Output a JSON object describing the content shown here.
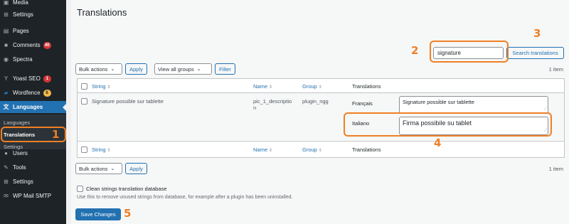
{
  "sidebar": {
    "items": [
      {
        "label": "Media",
        "icon": "media-icon"
      },
      {
        "label": "Settings",
        "icon": "settings-icon"
      },
      {
        "label": "Pages",
        "icon": "pages-icon"
      },
      {
        "label": "Comments",
        "icon": "comments-icon",
        "badge": "40"
      },
      {
        "label": "Spectra",
        "icon": "spectra-icon"
      },
      {
        "label": "Yoast SEO",
        "icon": "yoast-icon",
        "badge": "1"
      },
      {
        "label": "Wordfence",
        "icon": "wordfence-icon",
        "badge": "6"
      },
      {
        "label": "Languages",
        "icon": "languages-icon"
      },
      {
        "label": "Users",
        "icon": "users-icon"
      },
      {
        "label": "Tools",
        "icon": "tools-icon"
      },
      {
        "label": "Settings",
        "icon": "settings-icon"
      },
      {
        "label": "WP Mail SMTP",
        "icon": "mail-icon"
      }
    ],
    "submenu": [
      "Languages",
      "Translations",
      "Settings"
    ]
  },
  "page": {
    "title": "Translations"
  },
  "search": {
    "value": "signature",
    "button": "Search translations"
  },
  "bulk": {
    "label": "Bulk actions",
    "apply": "Apply",
    "groups": "View all groups",
    "filter": "Filter"
  },
  "count": "1 item",
  "table": {
    "headers": {
      "string": "String",
      "name": "Name",
      "group": "Group",
      "translations": "Translations"
    },
    "row": {
      "string": "Signature possible sur tablette",
      "name_line1": "pic_1_descriptio",
      "name_line2": "n",
      "group": "plugin_ngg",
      "translations": [
        {
          "lang": "Français",
          "value": "Signature possible sur tablette"
        },
        {
          "lang": "Italiano",
          "value": "Firma possibile su tablet"
        }
      ]
    }
  },
  "clean": {
    "label": "Clean strings translation database",
    "help": "Use this to remove unused strings from database, for example after a plugin has been uninstalled."
  },
  "save": "Save Changes",
  "annotations": [
    "1",
    "2",
    "3",
    "4",
    "5"
  ],
  "colors": {
    "accent": "#2271b1",
    "annotation": "#f08024",
    "sidebar": "#1d2327"
  }
}
